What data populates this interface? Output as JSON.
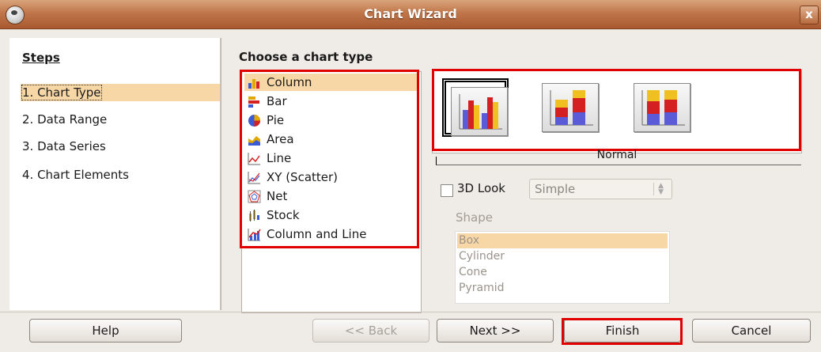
{
  "window": {
    "title": "Chart Wizard",
    "close_glyph": "x"
  },
  "steps": {
    "heading": "Steps",
    "items": [
      {
        "label": "1. Chart Type"
      },
      {
        "label": "2. Data Range"
      },
      {
        "label": "3. Data Series"
      },
      {
        "label": "4. Chart Elements"
      }
    ]
  },
  "chart_type": {
    "heading": "Choose a chart type",
    "types": [
      {
        "label": "Column",
        "icon": "column-chart-icon"
      },
      {
        "label": "Bar",
        "icon": "bar-chart-icon"
      },
      {
        "label": "Pie",
        "icon": "pie-chart-icon"
      },
      {
        "label": "Area",
        "icon": "area-chart-icon"
      },
      {
        "label": "Line",
        "icon": "line-chart-icon"
      },
      {
        "label": "XY (Scatter)",
        "icon": "scatter-chart-icon"
      },
      {
        "label": "Net",
        "icon": "net-chart-icon"
      },
      {
        "label": "Stock",
        "icon": "stock-chart-icon"
      },
      {
        "label": "Column and Line",
        "icon": "column-line-chart-icon"
      }
    ],
    "selected_variant_caption": "Normal",
    "look_3d_label": "3D Look",
    "look_3d_select": "Simple",
    "shape_label": "Shape",
    "shapes": [
      "Box",
      "Cylinder",
      "Cone",
      "Pyramid"
    ]
  },
  "buttons": {
    "help": "Help",
    "back": "<< Back",
    "next": "Next >>",
    "finish": "Finish",
    "cancel": "Cancel"
  },
  "colors": {
    "highlight": "#f8d7a7",
    "annotation": "#e00000",
    "titlebar": "#c0764a"
  }
}
